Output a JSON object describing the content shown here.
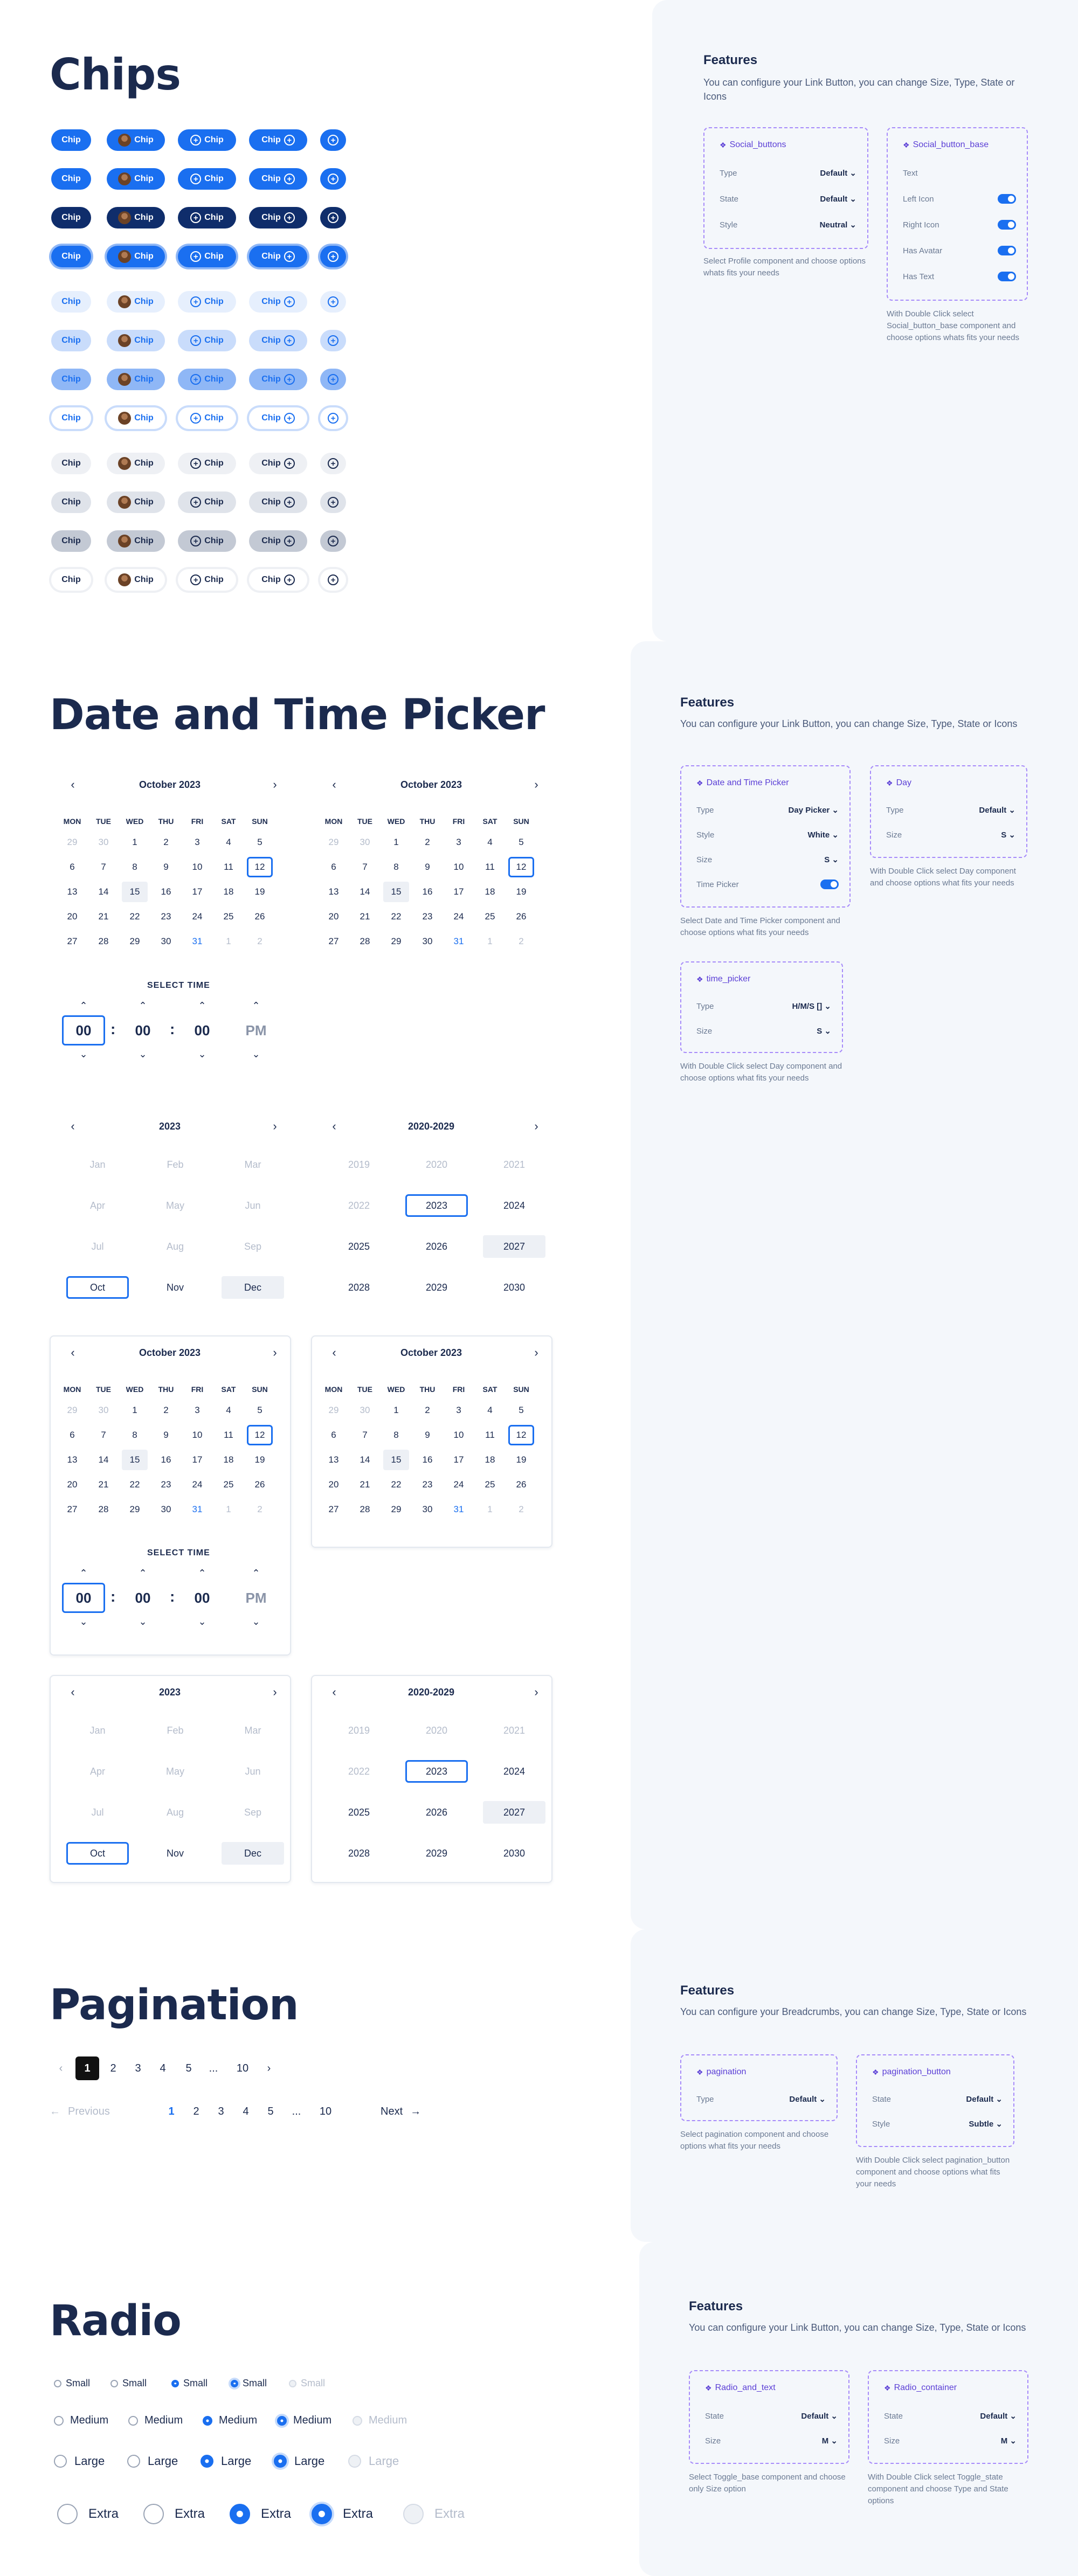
{
  "colors": {
    "accent": "#1a6ff0",
    "dark_navy": "#1b2a4e",
    "panel": "#f4f7fb",
    "feature_border": "#a78bfa"
  },
  "chips": {
    "title": "Chips",
    "label": "Chip",
    "icons": [
      "none",
      "avatar",
      "add-circle-icon",
      "add-circle-icon",
      "add-circle-icon"
    ],
    "features": {
      "title": "Features",
      "desc": "You can configure your Link Button, you can change Size, Type, State or Icons",
      "box1": {
        "title": "Social_buttons",
        "rows": [
          {
            "k": "Type",
            "v": "Default"
          },
          {
            "k": "State",
            "v": "Default"
          },
          {
            "k": "Style",
            "v": "Neutral"
          }
        ],
        "note": "Select Profile component and choose options whats fits your needs"
      },
      "box2": {
        "title": "Social_button_base",
        "rows": [
          {
            "k": "Text",
            "v": ""
          },
          {
            "k": "Left Icon",
            "v": "on"
          },
          {
            "k": "Right Icon",
            "v": "on"
          },
          {
            "k": "Has Avatar",
            "v": "on"
          },
          {
            "k": "Has Text",
            "v": "on"
          }
        ],
        "note": "With Double Click select Social_button_base component and choose options whats fits your needs"
      }
    }
  },
  "datetime": {
    "title": "Date and Time Picker",
    "month_label": "October  2023",
    "year_label": "2023",
    "decade_label": "2020-2029",
    "weekdays": [
      "MON",
      "TUE",
      "WED",
      "THU",
      "FRI",
      "SAT",
      "SUN"
    ],
    "days": [
      [
        "29",
        "30",
        "1",
        "2",
        "3",
        "4",
        "5"
      ],
      [
        "6",
        "7",
        "8",
        "9",
        "10",
        "11",
        "12"
      ],
      [
        "13",
        "14",
        "15",
        "16",
        "17",
        "18",
        "19"
      ],
      [
        "20",
        "21",
        "22",
        "23",
        "24",
        "25",
        "26"
      ],
      [
        "27",
        "28",
        "29",
        "30",
        "31",
        "1",
        "2"
      ]
    ],
    "months": [
      "Jan",
      "Feb",
      "Mar",
      "Apr",
      "May",
      "Jun",
      "Jul",
      "Aug",
      "Sep",
      "Oct",
      "Nov",
      "Dec"
    ],
    "years": [
      "2019",
      "2020",
      "2021",
      "2022",
      "2023",
      "2024",
      "2025",
      "2026",
      "2027",
      "2028",
      "2029",
      "2030"
    ],
    "select_time": "SELECT TIME",
    "time": {
      "h": "00",
      "m": "00",
      "s": "00",
      "ampm": "PM",
      "sep": ":"
    },
    "features": {
      "title": "Features",
      "desc": "You can configure your Link Button, you can change Size, Type, State or Icons",
      "box1": {
        "title": "Date and Time Picker",
        "rows": [
          {
            "k": "Type",
            "v": "Day Picker"
          },
          {
            "k": "Style",
            "v": "White"
          },
          {
            "k": "Size",
            "v": "S"
          },
          {
            "k": "Time Picker",
            "v": "on"
          }
        ],
        "note": "Select Date and Time Picker component and choose options what fits your needs"
      },
      "box2": {
        "title": "Day",
        "rows": [
          {
            "k": "Type",
            "v": "Default"
          },
          {
            "k": "Size",
            "v": "S"
          }
        ],
        "note": "With Double Click select Day component and choose options what fits your needs"
      },
      "box3": {
        "title": "time_picker",
        "rows": [
          {
            "k": "Type",
            "v": "H/M/S []"
          },
          {
            "k": "Size",
            "v": "S"
          }
        ],
        "note": "With Double Click select Day component and choose options what fits your needs"
      }
    }
  },
  "pagination": {
    "title": "Pagination",
    "pages": [
      "1",
      "2",
      "3",
      "4",
      "5",
      "...",
      "10"
    ],
    "prev": "Previous",
    "next": "Next",
    "features": {
      "title": "Features",
      "desc": "You can configure your Breadcrumbs, you can change Size, Type, State or Icons",
      "box1": {
        "title": "pagination",
        "rows": [
          {
            "k": "Type",
            "v": "Default"
          }
        ],
        "note": "Select pagination component and choose options what fits your needs"
      },
      "box2": {
        "title": "pagination_button",
        "rows": [
          {
            "k": "State",
            "v": "Default"
          },
          {
            "k": "Style",
            "v": "Subtle"
          }
        ],
        "note": "With Double Click select pagination_button component and choose options what fits your needs"
      }
    }
  },
  "radio": {
    "title": "Radio",
    "sizes": [
      "Small",
      "Medium",
      "Large",
      "Extra"
    ],
    "features": {
      "title": "Features",
      "desc": "You can configure your Link Button, you can change Size, Type, State or Icons",
      "box1": {
        "title": "Radio_and_text",
        "rows": [
          {
            "k": "State",
            "v": "Default"
          },
          {
            "k": "Size",
            "v": "M"
          }
        ],
        "note": "Select Toggle_base component and choose only Size option"
      },
      "box2": {
        "title": "Radio_container",
        "rows": [
          {
            "k": "State",
            "v": "Default"
          },
          {
            "k": "Size",
            "v": "M"
          }
        ],
        "note": "With Double Click select Toggle_state component and choose Type and State options"
      }
    }
  }
}
